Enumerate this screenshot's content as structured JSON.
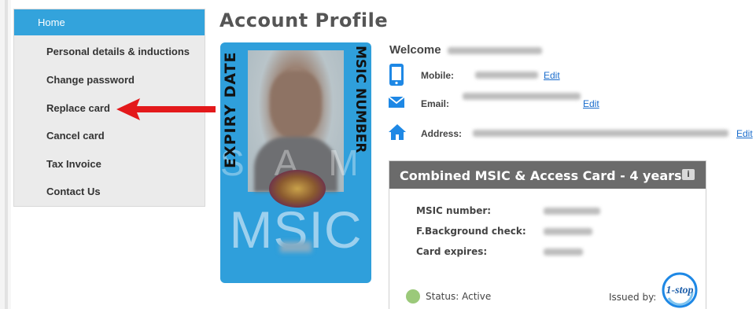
{
  "nav": {
    "items": [
      {
        "label": "Home",
        "active": true
      },
      {
        "label": "Personal details & inductions"
      },
      {
        "label": "Change password"
      },
      {
        "label": "Replace card"
      },
      {
        "label": "Cancel card"
      },
      {
        "label": "Tax Invoice"
      },
      {
        "label": "Contact Us"
      }
    ]
  },
  "page": {
    "title": "Account Profile"
  },
  "card": {
    "left_vertical": "EXPIRY DATE",
    "right_vertical": "MSIC NUMBER",
    "watermark": "SAMPLE",
    "type_text": "MSIC"
  },
  "profile": {
    "welcome_label": "Welcome",
    "rows": [
      {
        "icon": "mobile-phone-icon",
        "label": "Mobile:",
        "edit": "Edit"
      },
      {
        "icon": "envelope-icon",
        "label": "Email:",
        "edit": "Edit"
      },
      {
        "icon": "house-icon",
        "label": "Address:",
        "edit": "Edit"
      }
    ]
  },
  "card_panel": {
    "title": "Combined MSIC & Access Card - 4 years",
    "info_icon": "i",
    "fields": [
      {
        "label": "MSIC number:"
      },
      {
        "label": "F.Background check:"
      },
      {
        "label": "Card expires:"
      }
    ],
    "status": "Status: Active",
    "issued_by": "Issued by:",
    "issuer_logo_text": "1-stop"
  },
  "colors": {
    "nav_active": "#33a3dc",
    "card_blue": "#2f9fdb",
    "panel_header": "#6b6b6b",
    "link": "#1a6ccc",
    "status_active": "#9bc97a",
    "arrow": "#e3191b"
  }
}
